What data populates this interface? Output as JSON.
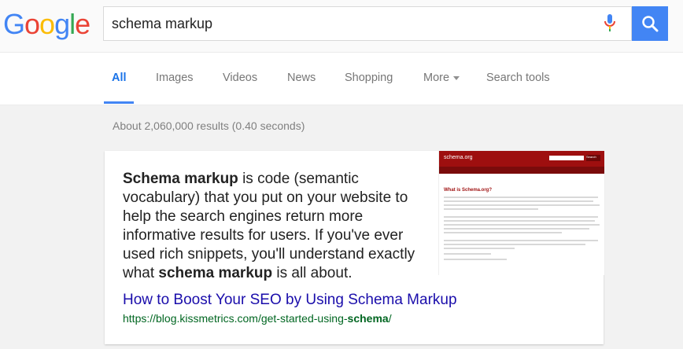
{
  "brand": {
    "logo_letters": [
      "G",
      "o",
      "o",
      "g",
      "l",
      "e"
    ],
    "logo_colors": [
      "#4285f4",
      "#ea4335",
      "#fbbc05",
      "#4285f4",
      "#34a853",
      "#ea4335"
    ],
    "accent": "#4285f4"
  },
  "search": {
    "query": "schema markup",
    "mic_icon": "microphone-icon",
    "button_icon": "search-icon"
  },
  "tabs": [
    {
      "label": "All",
      "active": true
    },
    {
      "label": "Images"
    },
    {
      "label": "Videos"
    },
    {
      "label": "News"
    },
    {
      "label": "Shopping"
    },
    {
      "label": "More",
      "dropdown": true
    },
    {
      "label": "Search tools"
    }
  ],
  "results_stats": "About 2,060,000 results (0.40 seconds)",
  "featured_snippet": {
    "text_parts": [
      {
        "text": "Schema markup",
        "bold": true
      },
      {
        "text": " is code (semantic vocabulary) that you put on your website to help the search engines return more informative results for users. If you've ever used rich snippets, you'll understand exactly what ",
        "bold": false
      },
      {
        "text": "schema markup",
        "bold": true
      },
      {
        "text": " is all about.",
        "bold": false
      }
    ],
    "title": "How to Boost Your SEO by Using Schema Markup",
    "url_prefix": "https://blog.kissmetrics.com/get-started-using-",
    "url_bold": "schema",
    "url_suffix": "/",
    "thumbnail": {
      "site_name": "schema.org",
      "heading": "What is Schema.org?",
      "button": "Search"
    }
  }
}
